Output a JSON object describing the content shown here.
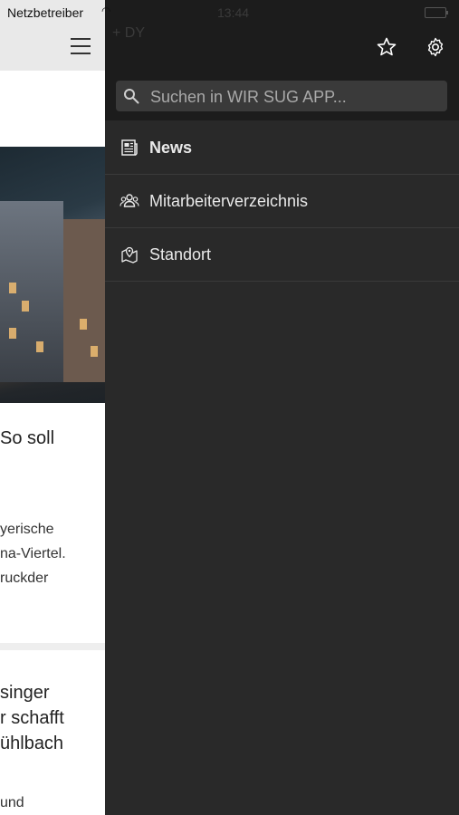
{
  "status_bar": {
    "carrier": "Netzbetreiber",
    "time": "13:44"
  },
  "drawer": {
    "ghost_title": "+ DY",
    "search": {
      "placeholder": "Suchen in WIR SUG APP..."
    },
    "items": [
      {
        "label": "News",
        "icon": "newspaper-icon",
        "active": true
      },
      {
        "label": "Mitarbeiterverzeichnis",
        "icon": "people-icon",
        "active": false
      },
      {
        "label": "Standort",
        "icon": "map-pin-icon",
        "active": false
      }
    ]
  },
  "underlay": {
    "article1_title": "So soll",
    "article1_body": [
      "yerische",
      "na-Viertel.",
      "ruckder"
    ],
    "article2_title": [
      "singer",
      "r schafft",
      "ühlbach"
    ],
    "article2_body": "und"
  }
}
